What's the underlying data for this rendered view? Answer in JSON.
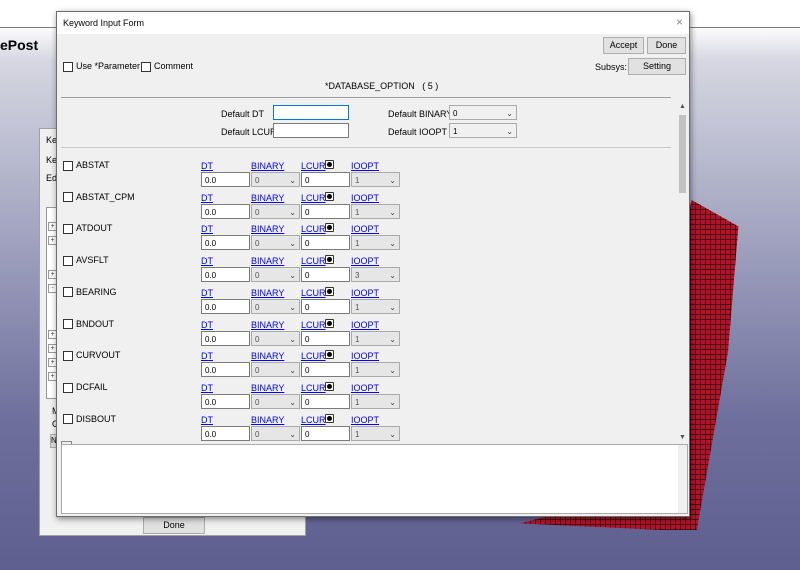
{
  "background_app": {
    "title_fragment": "ePost"
  },
  "bg_dialog": {
    "title_fragment": "Ke",
    "label1": "Ke",
    "label2": "Edi",
    "label3": "N",
    "label4": "M",
    "label5": "G",
    "label6": "N",
    "done_label": "Done"
  },
  "window": {
    "title": "Keyword Input Form",
    "close_icon": "×"
  },
  "header": {
    "accept_label": "Accept",
    "done_label": "Done",
    "use_parameter_label": "Use *Parameter",
    "comment_label": "Comment",
    "subsys_label": "Subsys:",
    "setting_label": "Setting",
    "keyword_title": "*DATABASE_OPTION",
    "keyword_count": "( 5 )"
  },
  "defaults": {
    "dt_label": "Default DT",
    "dt_value": "",
    "lcur_label": "Default LCUR",
    "lcur_value": "",
    "binary_label": "Default BINARY",
    "binary_value": "0",
    "ioopt_label": "Default IOOPT",
    "ioopt_value": "1"
  },
  "columns": {
    "dt": "DT",
    "binary": "BINARY",
    "lcur": "LCUR",
    "ioopt": "IOOPT"
  },
  "rows": [
    {
      "name": "ABSTAT",
      "dt": "0.0",
      "binary": "0",
      "lcur": "0",
      "ioopt": "1"
    },
    {
      "name": "ABSTAT_CPM",
      "dt": "0.0",
      "binary": "0",
      "lcur": "0",
      "ioopt": "1"
    },
    {
      "name": "ATDOUT",
      "dt": "0.0",
      "binary": "0",
      "lcur": "0",
      "ioopt": "1"
    },
    {
      "name": "AVSFLT",
      "dt": "0.0",
      "binary": "0",
      "lcur": "0",
      "ioopt": "3"
    },
    {
      "name": "BEARING",
      "dt": "0.0",
      "binary": "0",
      "lcur": "0",
      "ioopt": "1"
    },
    {
      "name": "BNDOUT",
      "dt": "0.0",
      "binary": "0",
      "lcur": "0",
      "ioopt": "1"
    },
    {
      "name": "CURVOUT",
      "dt": "0.0",
      "binary": "0",
      "lcur": "0",
      "ioopt": "1"
    },
    {
      "name": "DCFAIL",
      "dt": "0.0",
      "binary": "0",
      "lcur": "0",
      "ioopt": "1"
    },
    {
      "name": "DISBOUT",
      "dt": "0.0",
      "binary": "0",
      "lcur": "0",
      "ioopt": "1"
    }
  ],
  "icons": {
    "dropdown": "chevron-down-icon",
    "scroll_up": "▲",
    "scroll_down": "▼",
    "expand": "+",
    "collapse": "-"
  }
}
